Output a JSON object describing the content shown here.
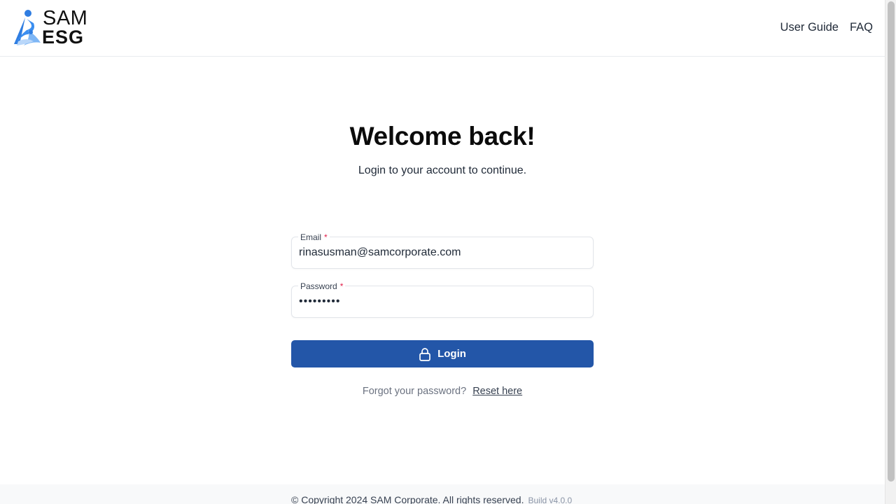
{
  "header": {
    "logo_top": "SAM",
    "logo_bottom": "ESG",
    "nav": [
      {
        "label": "User Guide"
      },
      {
        "label": "FAQ"
      }
    ]
  },
  "main": {
    "title": "Welcome back!",
    "subtitle": "Login to your account to continue.",
    "email": {
      "label": "Email",
      "required_marker": "*",
      "value": "rinasusman@samcorporate.com"
    },
    "password": {
      "label": "Password",
      "required_marker": "*",
      "value": "•••••••••"
    },
    "login_button": {
      "label": "Login",
      "icon": "lock-icon"
    },
    "forgot": {
      "text": "Forgot your password?",
      "link": "Reset here"
    }
  },
  "footer": {
    "copyright": "© Copyright 2024 SAM Corporate. All rights reserved.",
    "build": "Build v4.0.0"
  },
  "colors": {
    "primary": "#2356a8",
    "required": "#e11d48",
    "logo_blue": "#2f7de1"
  }
}
